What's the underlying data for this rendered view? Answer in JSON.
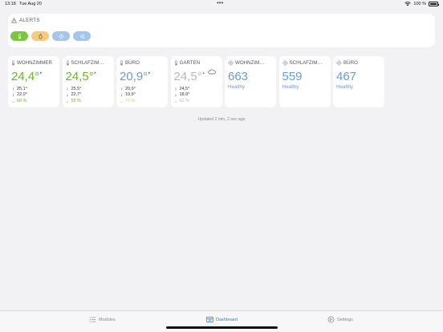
{
  "status_bar": {
    "time": "13:18",
    "date": "Tue Aug 20",
    "battery": "100 %",
    "dots": "•••"
  },
  "alerts": {
    "title": "ALERTS",
    "chips": [
      {
        "name": "thermometer",
        "bg": "#7cc444",
        "fg": "#ffffff"
      },
      {
        "name": "droplet",
        "bg": "#f5cc7f",
        "fg": "#5a4a2a"
      },
      {
        "name": "sensor",
        "bg": "#a4c6ea",
        "fg": "#ffffff"
      },
      {
        "name": "speaker",
        "bg": "#a4c6ea",
        "fg": "#ffffff"
      }
    ]
  },
  "cards": [
    {
      "kind": "temp",
      "name": "WOHNZIMMER",
      "value": "24,4°",
      "value_color": "#69b42e",
      "trend": "▸",
      "trend_color": "#2a7ed6",
      "max": "25,1°",
      "min": "22,0°",
      "humidity": "60 %",
      "humidity_color": "#69b42e"
    },
    {
      "kind": "temp",
      "name": "SCHLAFZIM…",
      "value": "24,5°",
      "value_color": "#69b42e",
      "trend": "▸",
      "trend_color": "#2a7ed6",
      "max": "25,5°",
      "min": "22,7°",
      "humidity": "55 %",
      "humidity_color": "#69b42e"
    },
    {
      "kind": "temp",
      "name": "BÜRO",
      "value": "20,9°",
      "value_color": "#6a9bd1",
      "trend": "▸",
      "trend_color": "#2a7ed6",
      "max": "20,9°",
      "min": "19,9°",
      "humidity": "77 %",
      "humidity_color": "#f0b860"
    },
    {
      "kind": "temp",
      "name": "GARTEN",
      "value": "24,5°",
      "value_color": "#b8b8bc",
      "trend": "▴",
      "trend_color": "#69b42e",
      "max": "24,5°",
      "min": "18,9°",
      "humidity": "62 %",
      "humidity_color": "#b8b8bc",
      "weather": "cloud"
    },
    {
      "kind": "co2",
      "name": "WOHNZIM…",
      "value": "663",
      "value_color": "#6a9bd1",
      "status": "Healthy"
    },
    {
      "kind": "co2",
      "name": "SCHLAFZIM…",
      "value": "559",
      "value_color": "#6a9bd1",
      "status": "Healthy"
    },
    {
      "kind": "co2",
      "name": "BÜRO",
      "value": "467",
      "value_color": "#6a9bd1",
      "status": "Healthy"
    }
  ],
  "updated": "Updated 2 min, 2 sec ago",
  "tabs": [
    {
      "label": "Modules",
      "icon": "list-icon",
      "active": false
    },
    {
      "label": "Dashboard",
      "icon": "dashboard-icon",
      "active": true
    },
    {
      "label": "Settings",
      "icon": "settings-icon",
      "active": false
    }
  ]
}
